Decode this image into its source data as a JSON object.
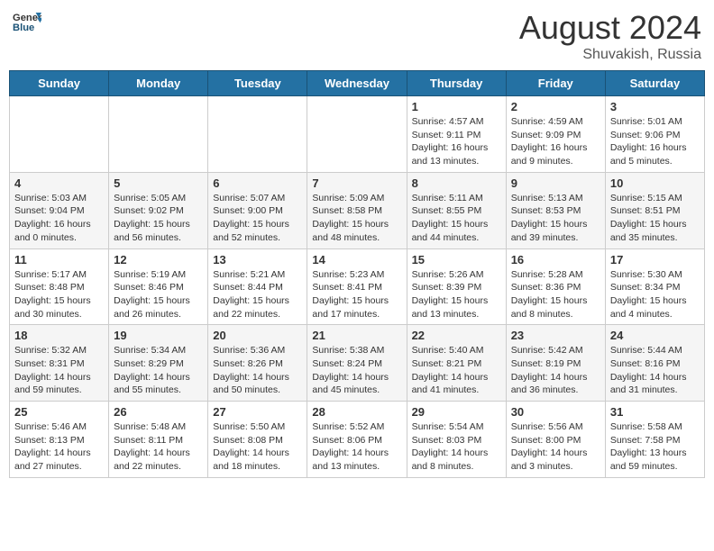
{
  "header": {
    "logo": {
      "general": "General",
      "blue": "Blue"
    },
    "title": "August 2024",
    "location": "Shuvakish, Russia"
  },
  "days_of_week": [
    "Sunday",
    "Monday",
    "Tuesday",
    "Wednesday",
    "Thursday",
    "Friday",
    "Saturday"
  ],
  "weeks": [
    [
      {
        "day": "",
        "info": ""
      },
      {
        "day": "",
        "info": ""
      },
      {
        "day": "",
        "info": ""
      },
      {
        "day": "",
        "info": ""
      },
      {
        "day": "1",
        "info": "Sunrise: 4:57 AM\nSunset: 9:11 PM\nDaylight: 16 hours\nand 13 minutes."
      },
      {
        "day": "2",
        "info": "Sunrise: 4:59 AM\nSunset: 9:09 PM\nDaylight: 16 hours\nand 9 minutes."
      },
      {
        "day": "3",
        "info": "Sunrise: 5:01 AM\nSunset: 9:06 PM\nDaylight: 16 hours\nand 5 minutes."
      }
    ],
    [
      {
        "day": "4",
        "info": "Sunrise: 5:03 AM\nSunset: 9:04 PM\nDaylight: 16 hours\nand 0 minutes."
      },
      {
        "day": "5",
        "info": "Sunrise: 5:05 AM\nSunset: 9:02 PM\nDaylight: 15 hours\nand 56 minutes."
      },
      {
        "day": "6",
        "info": "Sunrise: 5:07 AM\nSunset: 9:00 PM\nDaylight: 15 hours\nand 52 minutes."
      },
      {
        "day": "7",
        "info": "Sunrise: 5:09 AM\nSunset: 8:58 PM\nDaylight: 15 hours\nand 48 minutes."
      },
      {
        "day": "8",
        "info": "Sunrise: 5:11 AM\nSunset: 8:55 PM\nDaylight: 15 hours\nand 44 minutes."
      },
      {
        "day": "9",
        "info": "Sunrise: 5:13 AM\nSunset: 8:53 PM\nDaylight: 15 hours\nand 39 minutes."
      },
      {
        "day": "10",
        "info": "Sunrise: 5:15 AM\nSunset: 8:51 PM\nDaylight: 15 hours\nand 35 minutes."
      }
    ],
    [
      {
        "day": "11",
        "info": "Sunrise: 5:17 AM\nSunset: 8:48 PM\nDaylight: 15 hours\nand 30 minutes."
      },
      {
        "day": "12",
        "info": "Sunrise: 5:19 AM\nSunset: 8:46 PM\nDaylight: 15 hours\nand 26 minutes."
      },
      {
        "day": "13",
        "info": "Sunrise: 5:21 AM\nSunset: 8:44 PM\nDaylight: 15 hours\nand 22 minutes."
      },
      {
        "day": "14",
        "info": "Sunrise: 5:23 AM\nSunset: 8:41 PM\nDaylight: 15 hours\nand 17 minutes."
      },
      {
        "day": "15",
        "info": "Sunrise: 5:26 AM\nSunset: 8:39 PM\nDaylight: 15 hours\nand 13 minutes."
      },
      {
        "day": "16",
        "info": "Sunrise: 5:28 AM\nSunset: 8:36 PM\nDaylight: 15 hours\nand 8 minutes."
      },
      {
        "day": "17",
        "info": "Sunrise: 5:30 AM\nSunset: 8:34 PM\nDaylight: 15 hours\nand 4 minutes."
      }
    ],
    [
      {
        "day": "18",
        "info": "Sunrise: 5:32 AM\nSunset: 8:31 PM\nDaylight: 14 hours\nand 59 minutes."
      },
      {
        "day": "19",
        "info": "Sunrise: 5:34 AM\nSunset: 8:29 PM\nDaylight: 14 hours\nand 55 minutes."
      },
      {
        "day": "20",
        "info": "Sunrise: 5:36 AM\nSunset: 8:26 PM\nDaylight: 14 hours\nand 50 minutes."
      },
      {
        "day": "21",
        "info": "Sunrise: 5:38 AM\nSunset: 8:24 PM\nDaylight: 14 hours\nand 45 minutes."
      },
      {
        "day": "22",
        "info": "Sunrise: 5:40 AM\nSunset: 8:21 PM\nDaylight: 14 hours\nand 41 minutes."
      },
      {
        "day": "23",
        "info": "Sunrise: 5:42 AM\nSunset: 8:19 PM\nDaylight: 14 hours\nand 36 minutes."
      },
      {
        "day": "24",
        "info": "Sunrise: 5:44 AM\nSunset: 8:16 PM\nDaylight: 14 hours\nand 31 minutes."
      }
    ],
    [
      {
        "day": "25",
        "info": "Sunrise: 5:46 AM\nSunset: 8:13 PM\nDaylight: 14 hours\nand 27 minutes."
      },
      {
        "day": "26",
        "info": "Sunrise: 5:48 AM\nSunset: 8:11 PM\nDaylight: 14 hours\nand 22 minutes."
      },
      {
        "day": "27",
        "info": "Sunrise: 5:50 AM\nSunset: 8:08 PM\nDaylight: 14 hours\nand 18 minutes."
      },
      {
        "day": "28",
        "info": "Sunrise: 5:52 AM\nSunset: 8:06 PM\nDaylight: 14 hours\nand 13 minutes."
      },
      {
        "day": "29",
        "info": "Sunrise: 5:54 AM\nSunset: 8:03 PM\nDaylight: 14 hours\nand 8 minutes."
      },
      {
        "day": "30",
        "info": "Sunrise: 5:56 AM\nSunset: 8:00 PM\nDaylight: 14 hours\nand 3 minutes."
      },
      {
        "day": "31",
        "info": "Sunrise: 5:58 AM\nSunset: 7:58 PM\nDaylight: 13 hours\nand 59 minutes."
      }
    ]
  ]
}
